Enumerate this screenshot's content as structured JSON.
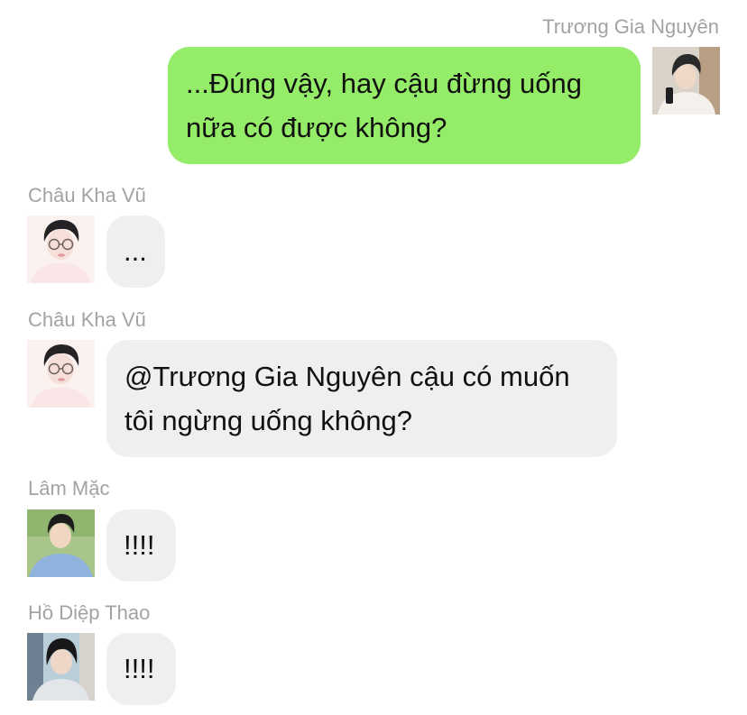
{
  "chat": {
    "messages": [
      {
        "sender": "Trương Gia Nguyên",
        "avatar": "boy-white-shirt-avatar",
        "text": "...Đúng vậy, hay cậu đừng uống nữa có được không?",
        "direction": "outgoing"
      },
      {
        "sender": "Châu Kha Vũ",
        "avatar": "boy-glasses-avatar",
        "text": "...",
        "direction": "incoming"
      },
      {
        "sender": "Châu Kha Vũ",
        "avatar": "boy-glasses-avatar",
        "text": "@Trương Gia Nguyên cậu có muốn tôi ngừng uống không?",
        "direction": "incoming"
      },
      {
        "sender": "Lâm Mặc",
        "avatar": "boy-blue-shirt-avatar",
        "text": "!!!!",
        "direction": "incoming"
      },
      {
        "sender": "Hồ Diệp Thao",
        "avatar": "boy-dark-hair-avatar",
        "text": "!!!!",
        "direction": "incoming"
      }
    ]
  },
  "colors": {
    "outgoing_bubble": "#95ec69",
    "incoming_bubble": "#efefef",
    "sender_name": "#a3a3a3",
    "text": "#111111"
  }
}
